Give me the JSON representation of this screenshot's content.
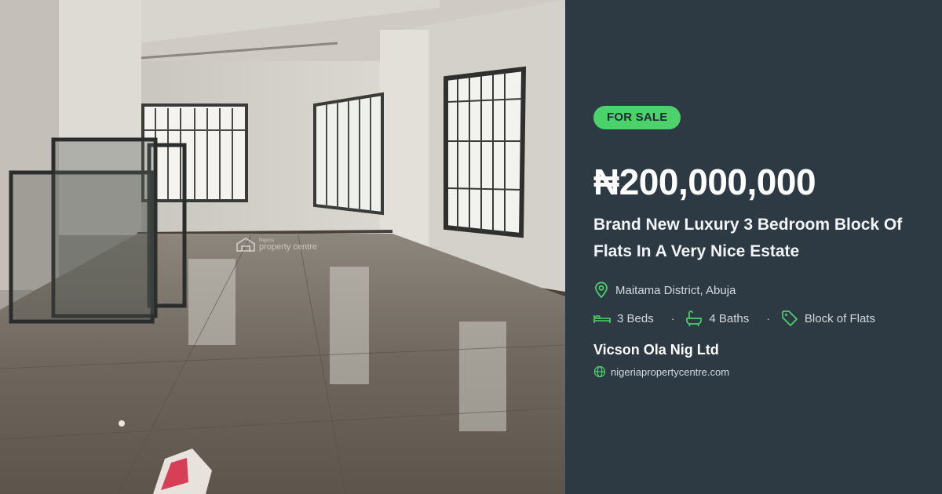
{
  "photo": {
    "watermark_small": "Nigeria",
    "watermark_big": "property centre"
  },
  "listing": {
    "badge": "FOR SALE",
    "price": "₦200,000,000",
    "title": "Brand New Luxury 3 Bedroom Block Of Flats In A Very Nice Estate",
    "location": "Maitama District, Abuja",
    "beds": "3 Beds",
    "separator": "·",
    "baths": "4 Baths",
    "type": "Block of Flats",
    "agent": "Vicson Ola Nig Ltd",
    "website": "nigeriapropertycentre.com"
  },
  "colors": {
    "panel_bg": "#2d3a44",
    "accent_green": "#4cd26b",
    "text_primary": "#ffffff",
    "text_secondary": "#d3d9dd"
  },
  "icons": {
    "location": "map-pin-icon",
    "beds": "bed-icon",
    "baths": "bathtub-icon",
    "type": "tag-icon",
    "website": "globe-icon"
  }
}
